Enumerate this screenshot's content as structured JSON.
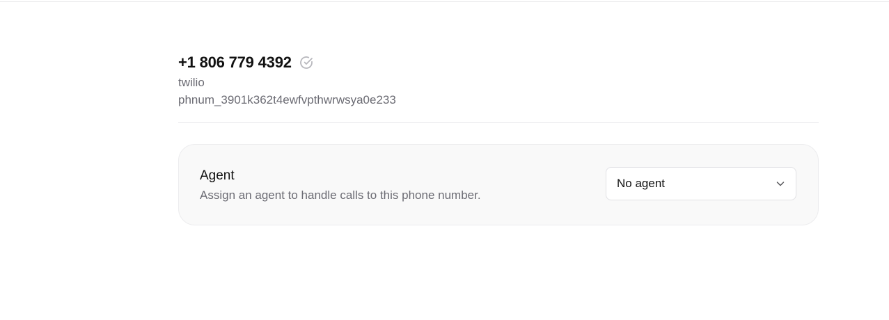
{
  "phone": {
    "number": "+1 806 779 4392",
    "verified_icon": "check-circle-icon",
    "provider": "twilio",
    "id": "phnum_3901k362t4ewfvpthwrwsya0e233"
  },
  "agent_section": {
    "title": "Agent",
    "description": "Assign an agent to handle calls to this phone number.",
    "select": {
      "value": "No agent",
      "icon": "chevron-down-icon"
    }
  },
  "colors": {
    "text_primary": "#111111",
    "text_secondary": "#6b6b73",
    "card_background": "#f9f9f9",
    "border": "#e8e8ea",
    "icon_muted": "#b8b8bd"
  }
}
